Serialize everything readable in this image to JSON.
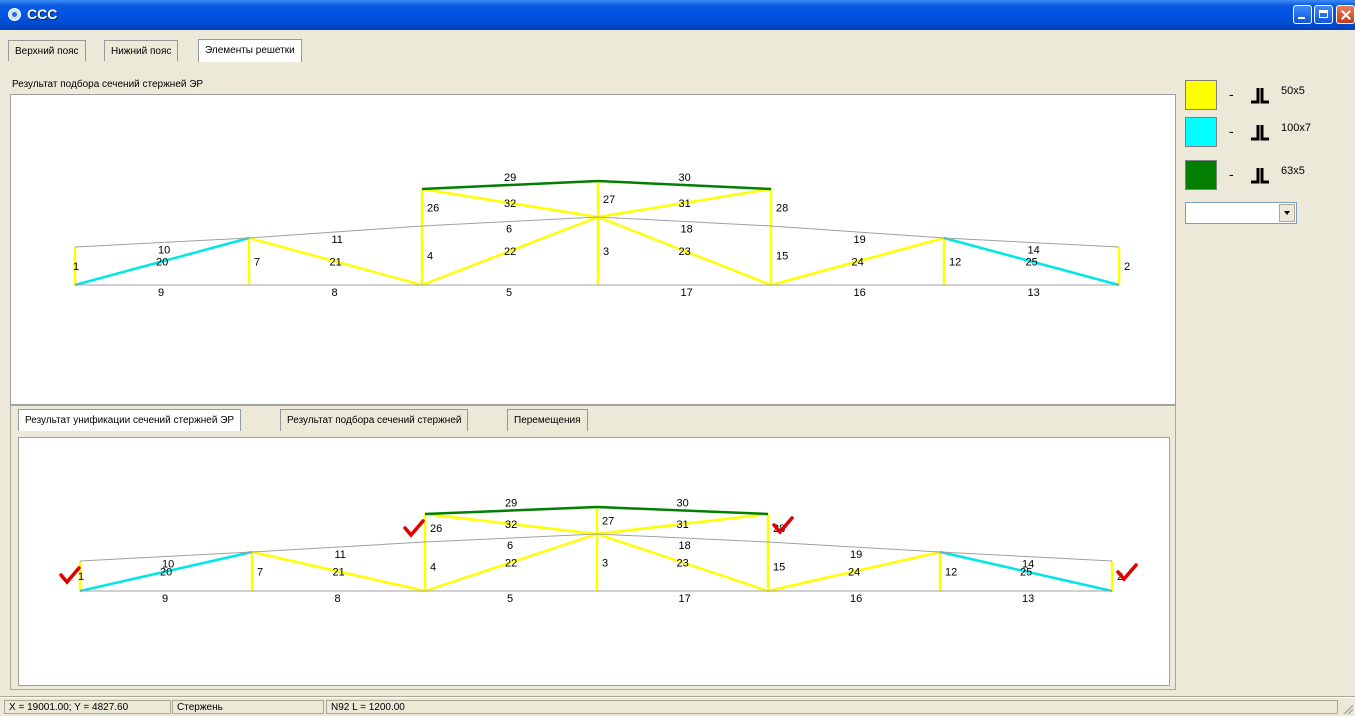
{
  "window": {
    "title": "CCC",
    "icon": "app-icon",
    "controls": [
      "minimize-icon",
      "maximize-icon",
      "close-icon"
    ]
  },
  "tabs": [
    {
      "label": "Верхний пояс",
      "active": false
    },
    {
      "label": "Нижний пояс",
      "active": false
    },
    {
      "label": "Элементы решетки",
      "active": true
    }
  ],
  "upper_panel": {
    "label": "Результат подбора сечений стержней ЭР"
  },
  "lower_tabs": [
    {
      "label": "Результат унификации сечений стержней ЭР",
      "active": true
    },
    {
      "label": "Результат подбора сечений стержней",
      "active": false
    },
    {
      "label": "Перемещения",
      "active": false
    }
  ],
  "legend": [
    {
      "color": "#ffff00",
      "dash": "-",
      "icon": "double-angle-icon",
      "label": "50x5"
    },
    {
      "color": "#00ffff",
      "dash": "-",
      "icon": "double-angle-icon",
      "label": "100x7"
    },
    {
      "color": "#007f00",
      "dash": "-",
      "icon": "double-angle-icon",
      "label": "63x5"
    }
  ],
  "dropdown": {
    "selected": ""
  },
  "status": {
    "coords": "X = 19001.00; Y = 4827.60",
    "object": "Стержень",
    "info": "N92 L = 1200.00"
  },
  "truss": {
    "colors": {
      "chord": "#a0a0a0",
      "yellow": "#ffff00",
      "cyan": "#00e5e5",
      "green": "#007f00",
      "check": "#e00000"
    },
    "members": [
      {
        "id": "1",
        "from": "L0",
        "to": "U0",
        "color": "yellow",
        "label_at": "left"
      },
      {
        "id": "7",
        "from": "L1",
        "to": "U1",
        "color": "yellow",
        "label_at": "right"
      },
      {
        "id": "4",
        "from": "L2",
        "to": "U2",
        "color": "yellow",
        "label_at": "right"
      },
      {
        "id": "26",
        "from": "U2",
        "to": "T0",
        "color": "yellow",
        "label_at": "right"
      },
      {
        "id": "3",
        "from": "L3",
        "to": "U3",
        "color": "yellow",
        "label_at": "right"
      },
      {
        "id": "27",
        "from": "U3",
        "to": "T1",
        "color": "yellow",
        "label_at": "right"
      },
      {
        "id": "15",
        "from": "L4",
        "to": "U4",
        "color": "yellow",
        "label_at": "right"
      },
      {
        "id": "28",
        "from": "U4",
        "to": "T2",
        "color": "yellow",
        "label_at": "right"
      },
      {
        "id": "12",
        "from": "L5",
        "to": "U5",
        "color": "yellow",
        "label_at": "right"
      },
      {
        "id": "2",
        "from": "L6",
        "to": "U6",
        "color": "yellow",
        "label_at": "right"
      },
      {
        "id": "20",
        "from": "L0",
        "to": "U1",
        "color": "cyan",
        "label_at": "mid"
      },
      {
        "id": "21",
        "from": "U1",
        "to": "L2",
        "color": "yellow",
        "label_at": "mid"
      },
      {
        "id": "22",
        "from": "L2",
        "to": "U3",
        "color": "yellow",
        "label_at": "mid"
      },
      {
        "id": "23",
        "from": "U3",
        "to": "L4",
        "color": "yellow",
        "label_at": "mid"
      },
      {
        "id": "24",
        "from": "L4",
        "to": "U5",
        "color": "yellow",
        "label_at": "mid"
      },
      {
        "id": "25",
        "from": "U5",
        "to": "L6",
        "color": "cyan",
        "label_at": "mid"
      },
      {
        "id": "32",
        "from": "T0",
        "to": "U3",
        "color": "yellow",
        "label_at": "mid"
      },
      {
        "id": "31",
        "from": "U3",
        "to": "T2",
        "color": "yellow",
        "label_at": "mid"
      },
      {
        "id": "29",
        "from": "T0",
        "to": "T1",
        "color": "green",
        "label_at": "above"
      },
      {
        "id": "30",
        "from": "T1",
        "to": "T2",
        "color": "green",
        "label_at": "above"
      },
      {
        "id": "10",
        "from": "U0",
        "to": "U1",
        "color": "chord",
        "label_at": "below"
      },
      {
        "id": "11",
        "from": "U1",
        "to": "U2",
        "color": "chord",
        "label_at": "below"
      },
      {
        "id": "6",
        "from": "U2",
        "to": "U3",
        "color": "chord",
        "label_at": "below"
      },
      {
        "id": "18",
        "from": "U3",
        "to": "U4",
        "color": "chord",
        "label_at": "below"
      },
      {
        "id": "19",
        "from": "U4",
        "to": "U5",
        "color": "chord",
        "label_at": "below"
      },
      {
        "id": "14",
        "from": "U5",
        "to": "U6",
        "color": "chord",
        "label_at": "below"
      },
      {
        "id": "9",
        "from": "L0",
        "to": "L1",
        "color": "chord",
        "label_at": "below"
      },
      {
        "id": "8",
        "from": "L1",
        "to": "L2",
        "color": "chord",
        "label_at": "below"
      },
      {
        "id": "5",
        "from": "L2",
        "to": "L3",
        "color": "chord",
        "label_at": "below"
      },
      {
        "id": "17",
        "from": "L3",
        "to": "L4",
        "color": "chord",
        "label_at": "below"
      },
      {
        "id": "16",
        "from": "L4",
        "to": "L5",
        "color": "chord",
        "label_at": "below"
      },
      {
        "id": "13",
        "from": "L5",
        "to": "L6",
        "color": "chord",
        "label_at": "below"
      }
    ],
    "checks_lower": [
      "1",
      "26",
      "28",
      "2"
    ]
  }
}
